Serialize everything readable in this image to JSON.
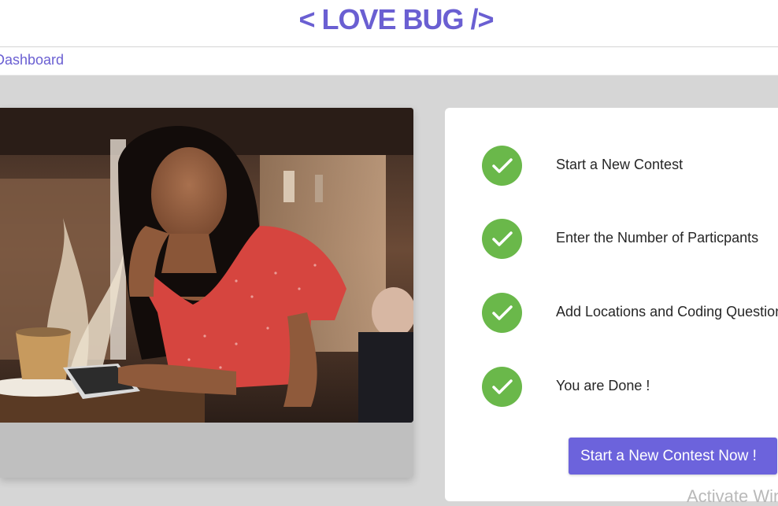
{
  "header": {
    "brand": "< LOVE BUG />"
  },
  "breadcrumb": {
    "label": "Dashboard"
  },
  "steps": [
    {
      "label": "Start a New Contest",
      "icon": "check-icon"
    },
    {
      "label": "Enter the Number of Particpants",
      "icon": "check-icon"
    },
    {
      "label": "Add Locations and Coding Questions",
      "icon": "check-icon"
    },
    {
      "label": "You are Done !",
      "icon": "check-icon"
    }
  ],
  "cta": {
    "label": "Start a New Contest Now !"
  },
  "watermark": {
    "text": "Activate Windows"
  },
  "colors": {
    "accent": "#6c63dc",
    "brand": "#6a5fd2",
    "check": "#6ab84a",
    "background": "#d6d6d6"
  }
}
